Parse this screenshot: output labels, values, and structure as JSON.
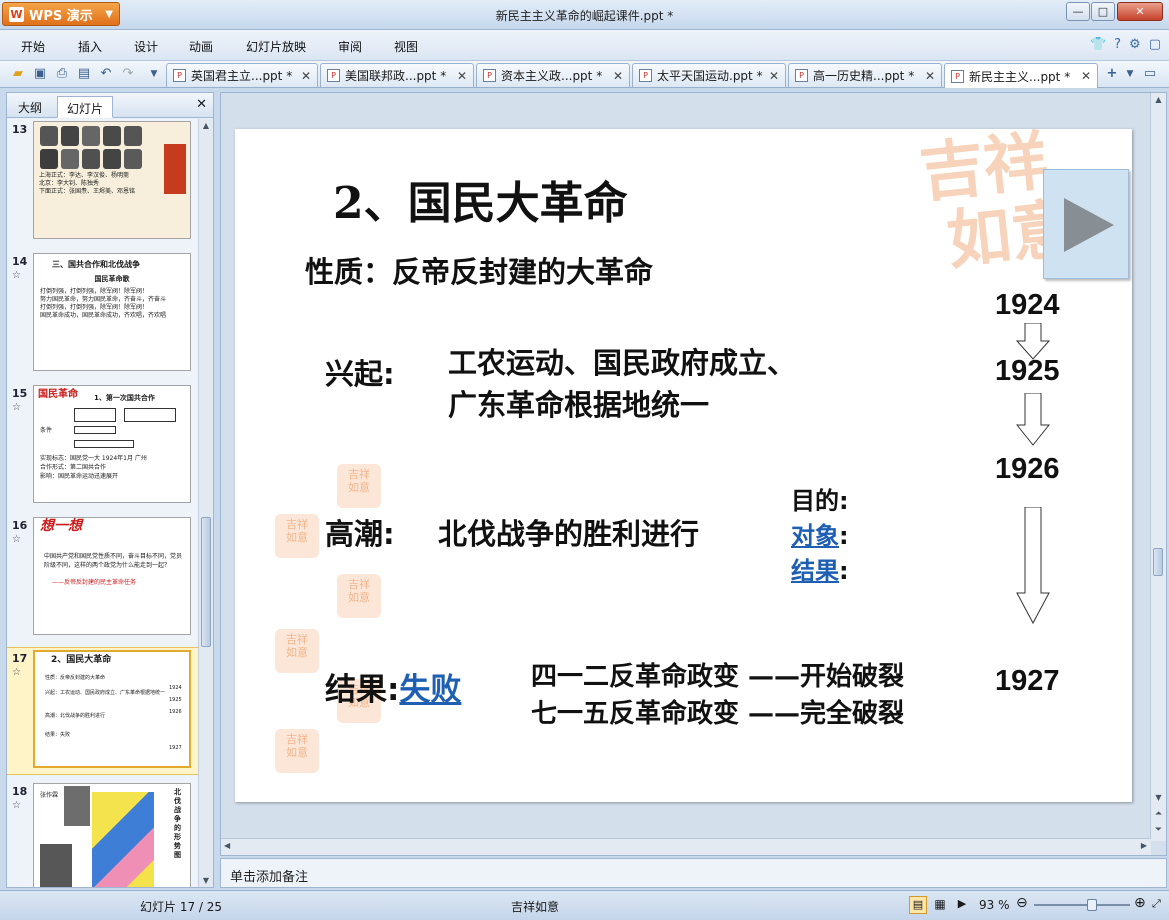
{
  "app": {
    "name": "WPS 演示",
    "logo": "W"
  },
  "window": {
    "title": "新民主主义革命的崛起课件.ppt *"
  },
  "menu": [
    "开始",
    "插入",
    "设计",
    "动画",
    "幻灯片放映",
    "审阅",
    "视图"
  ],
  "doc_tabs": [
    {
      "label": "英国君主立...ppt *"
    },
    {
      "label": "美国联邦政...ppt *"
    },
    {
      "label": "资本主义政...ppt *"
    },
    {
      "label": "太平天国运动.ppt *"
    },
    {
      "label": "高一历史精...ppt *"
    },
    {
      "label": "新民主主义...ppt *",
      "active": true
    }
  ],
  "left_panel": {
    "tabs": [
      "大纲",
      "幻灯片"
    ],
    "thumbs": [
      {
        "num": "13",
        "star": "",
        "lines": [
          "上海正式：李达、李汉俊、杨明斋",
          "北京：李大钊、陈独秀",
          "下面正式：张国焘、王烬美、邓恩铭"
        ]
      },
      {
        "num": "14",
        "star": "☆",
        "title": "三、国共合作和北伐战争",
        "subtitle": "国民革命歌",
        "lines": [
          "打倒列强，打倒列强，除军阀！除军阀！",
          "努力国民革命，努力国民革命，齐奋斗，齐奋斗",
          "打倒列强，打倒列强，除军阀！除军阀！",
          "国民革命成功，国民革命成功，齐欢唱，齐欢唱"
        ]
      },
      {
        "num": "15",
        "star": "☆",
        "title": "国民革命",
        "subtitle": "1、第一次国共合作",
        "lines": [
          "条件",
          "实现标志：国民党一大 1924年1月 广州",
          "合作形式：第二国共合作",
          "影响：国民革命运动迅速展开"
        ]
      },
      {
        "num": "16",
        "star": "☆",
        "title": "想一想",
        "lines": [
          "中国共产党和国民党性质不同，奋斗目标不同，党员阶级不同，这样的两个政党为什么能走到一起？",
          "——反帝反封建的民主革命任务"
        ]
      },
      {
        "num": "17",
        "star": "☆",
        "title": "2、国民大革命",
        "selected": true,
        "lines": [
          "性质：反帝反封建的大革命",
          "兴起：工农运动、国民政府成立、广东革命根据地统一",
          "高潮：北伐战争的胜利进行",
          "结果：失败"
        ]
      },
      {
        "num": "18",
        "star": "☆",
        "lines": [
          "张作霖",
          "北伐战争的形势图"
        ]
      }
    ]
  },
  "slide": {
    "title": "2、国民大革命",
    "nature": "性质：反帝反封建的大革命",
    "rise_label": "兴起:",
    "rise_line1": "工农运动、国民政府成立、",
    "rise_line2": "广东革命根据地统一",
    "climax_label": "高潮:",
    "climax_text": "北伐战争的胜利进行",
    "purpose": "目的:",
    "target": "对象",
    "target_colon": ":",
    "outcome": "结果",
    "outcome_colon": ":",
    "result_label": "结果:",
    "result_link": "失败",
    "coup1": "四一二反革命政变 ——开始破裂",
    "coup2": "七一五反革命政变 ——完全破裂",
    "years": [
      "1924",
      "1925",
      "1926",
      "1927"
    ],
    "watermark": "吉祥如意"
  },
  "notes": {
    "placeholder": "单击添加备注"
  },
  "status": {
    "slide_counter": "幻灯片 17 / 25",
    "theme": "吉祥如意",
    "zoom": "93 %",
    "zoom_level": 0.62
  }
}
